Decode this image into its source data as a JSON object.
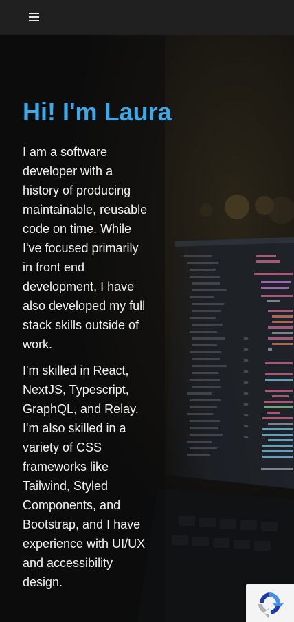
{
  "header": {
    "menu_icon": "hamburger-menu-icon"
  },
  "hero": {
    "title": "Hi! I'm Laura",
    "paragraph_1": "I am a software developer with a history of producing maintainable, reusable code on time. While I've focused primarily in front end development, I have also developed my full stack skills outside of work.",
    "paragraph_2": "I'm skilled in React, NextJS, Typescript, GraphQL, and Relay. I'm also skilled in a variety of CSS frameworks like Tailwind, Styled Components, and Bootstrap, and I have experience with UI/UX and accessibility design.",
    "background_image": "laptop-code-editor-photo"
  },
  "recaptcha": {
    "icon": "recaptcha-icon"
  },
  "colors": {
    "accent": "#3da9e6",
    "text": "#f2f2f2",
    "topbar": "#202020",
    "background": "#0c0c0d"
  }
}
